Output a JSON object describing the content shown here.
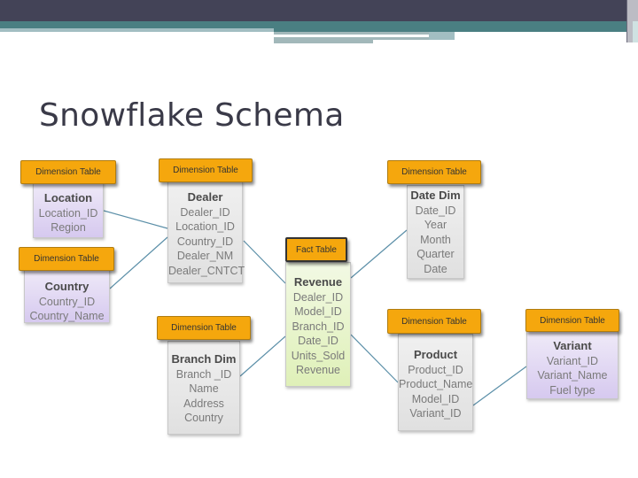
{
  "slide": {
    "title": "Snowflake Schema"
  },
  "tables": {
    "location": {
      "header": "Dimension Table",
      "name": "Location",
      "fields": [
        "Location_ID",
        "Region"
      ]
    },
    "country": {
      "header": "Dimension Table",
      "name": "Country",
      "fields": [
        "Country_ID",
        "Country_Name"
      ]
    },
    "dealer": {
      "header": "Dimension Table",
      "name": "Dealer",
      "fields": [
        "Dealer_ID",
        "Location_ID",
        "Country_ID",
        "Dealer_NM",
        "Dealer_CNTCT"
      ]
    },
    "revenue": {
      "header": "Fact Table",
      "name": "Revenue",
      "fields": [
        "Dealer_ID",
        "Model_ID",
        "Branch_ID",
        "Date_ID",
        "Units_Sold",
        "Revenue"
      ]
    },
    "branch": {
      "header": "Dimension Table",
      "name": "Branch Dim",
      "fields": [
        "Branch _ID",
        "Name",
        "Address",
        "Country"
      ]
    },
    "date": {
      "header": "Dimension Table",
      "name": "Date Dim",
      "fields": [
        "Date_ID",
        "Year",
        "Month",
        "Quarter",
        "Date"
      ]
    },
    "product": {
      "header": "Dimension Table",
      "name": "Product",
      "fields": [
        "Product_ID",
        "Product_Name",
        "Model_ID",
        "Variant_ID"
      ]
    },
    "variant": {
      "header": "Dimension Table",
      "name": "Variant",
      "fields": [
        "Variant_ID",
        "Variant_Name",
        "Fuel type"
      ]
    }
  },
  "relationships": [
    {
      "from": "location",
      "to": "dealer"
    },
    {
      "from": "country",
      "to": "dealer"
    },
    {
      "from": "dealer",
      "to": "revenue"
    },
    {
      "from": "branch",
      "to": "revenue"
    },
    {
      "from": "date",
      "to": "revenue"
    },
    {
      "from": "product",
      "to": "revenue"
    },
    {
      "from": "variant",
      "to": "product"
    }
  ],
  "colors": {
    "header_bg": "#f5a70d",
    "connector": "#5b8fa8",
    "dimension_purple": "#ddd2f1",
    "dimension_gray": "#e4e4e4",
    "fact_green": "#e4f3c4",
    "title_bar": "#434357",
    "accent_teal": "#4a7f82"
  }
}
